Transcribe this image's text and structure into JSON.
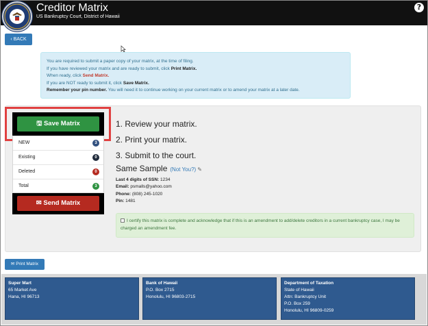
{
  "header": {
    "title": "Creditor Matrix",
    "subtitle": "US Bankruptcy Court, District of Hawaii",
    "help_label": "?"
  },
  "back_button": {
    "label": "BACK",
    "icon": "chevron-left-icon"
  },
  "info": {
    "line1": "You are required to submit a paper copy of your matrix, at the time of filing.",
    "line2_prefix": "If you have reviewed your matrix and are ready to submit, click ",
    "line2_bold": "Print Matrix.",
    "line3_prefix": "When ready, click ",
    "line3_bold": "Send Matrix.",
    "line4_prefix": "If you are NOT ready to submit it, click ",
    "line4_bold": "Save Matrix.",
    "line5_bold": "Remember your pin number.",
    "line5_rest": " You will need it to continue working on your current matrix or to amend your matrix at a later date."
  },
  "save_button": {
    "label": "Save Matrix",
    "icon": "save-disk-icon"
  },
  "send_button": {
    "label": "Send Matrix",
    "icon": "envelope-icon"
  },
  "status": [
    {
      "label": "NEW",
      "count": "3",
      "color": "#31507f"
    },
    {
      "label": "Existing",
      "count": "0",
      "color": "#1f2a3a"
    },
    {
      "label": "Deleted",
      "count": "0",
      "color": "#b52a20"
    },
    {
      "label": "Total",
      "count": "3",
      "color": "#2f9342"
    }
  ],
  "steps": [
    "1. Review your matrix.",
    "2. Print your matrix.",
    "3. Submit to the court."
  ],
  "debtor": {
    "name": "Same Sample",
    "not_you": "(Not You?)",
    "ssn_label": "Last 4 digits of SSN:",
    "ssn": "1234",
    "email_label": "Email:",
    "email": "psmalls@yahoo.com",
    "phone_label": "Phone:",
    "phone": "(808) 245-1020",
    "pin_label": "Pin:",
    "pin": "1481"
  },
  "certify": {
    "text": "I certify this matrix is complete and acknowledge that if this is an amendment to add/delete creditors in a current bankruptcy case, I may be charged an amendment fee."
  },
  "print_button": {
    "label": "Print Matrix",
    "icon": "envelope-icon"
  },
  "creditors": [
    {
      "name": "Super Mart",
      "lines": [
        "65 Market Ave",
        "Hana, HI 96713"
      ]
    },
    {
      "name": "Bank of Hawaii",
      "lines": [
        "P.O. Box 2715",
        "Honolulu, HI 96803-2715"
      ]
    },
    {
      "name": "Department of Taxation",
      "lines": [
        "State of Hawaii",
        "Attn: Bankruptcy Unit",
        "P.O. Box 259",
        "Honolulu, HI 96809-0259"
      ]
    }
  ],
  "colors": {
    "header_bg": "#111111",
    "primary": "#337ab7",
    "save_green": "#2f9342",
    "send_red": "#b52a20",
    "card_blue": "#2f5a8f",
    "highlight": "#e04040"
  }
}
